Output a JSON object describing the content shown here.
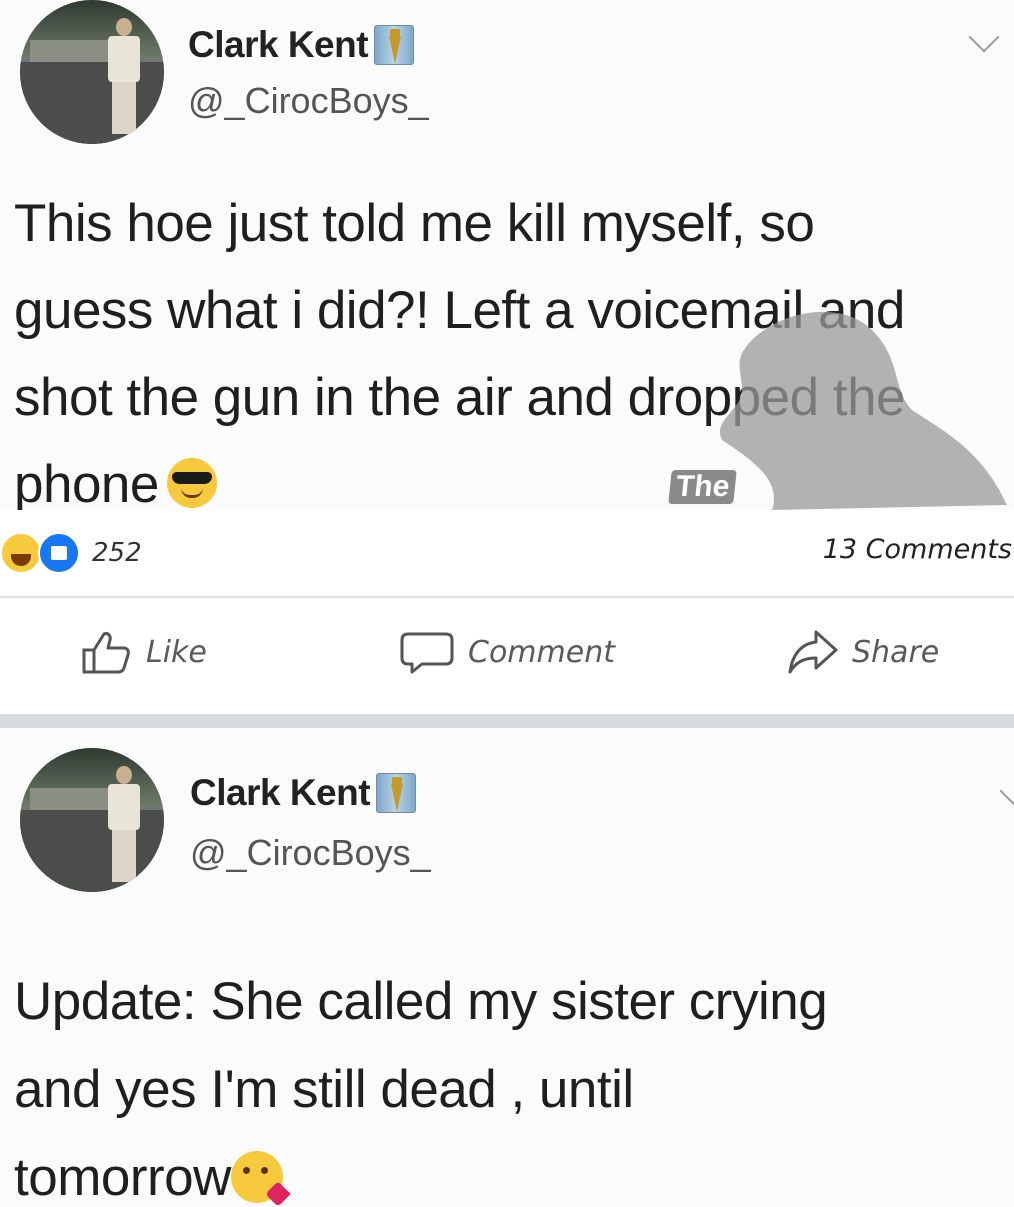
{
  "post_top": {
    "display_name": "Clark Kent",
    "handle": "@_CirocBoys_",
    "text_lines": [
      "This hoe just told me kill myself, so",
      "guess what i did?! Left a voicemail and",
      "shot the gun in the air and dropped the",
      "phone"
    ],
    "watermark": "The"
  },
  "engagement": {
    "reaction_count": "252",
    "comments_count": "13 Comments",
    "like_label": "Like",
    "comment_label": "Comment",
    "share_label": "Share"
  },
  "post_bottom": {
    "display_name": "Clark Kent",
    "handle": "@_CirocBoys_",
    "text_lines": [
      "Update: She called my sister crying",
      "and yes I'm still dead , until",
      "tomorrow"
    ]
  },
  "icons": [
    "tie-icon",
    "chevron-down-icon",
    "sunglasses-emoji",
    "haha-reaction-icon",
    "like-reaction-icon",
    "like-icon",
    "comment-icon",
    "share-icon",
    "kiss-emoji"
  ],
  "colors": {
    "facebook_blue": "#1877f2",
    "emoji_yellow": "#f7c93c",
    "divider": "#e0e0e0",
    "section_gap": "#d7dade"
  }
}
